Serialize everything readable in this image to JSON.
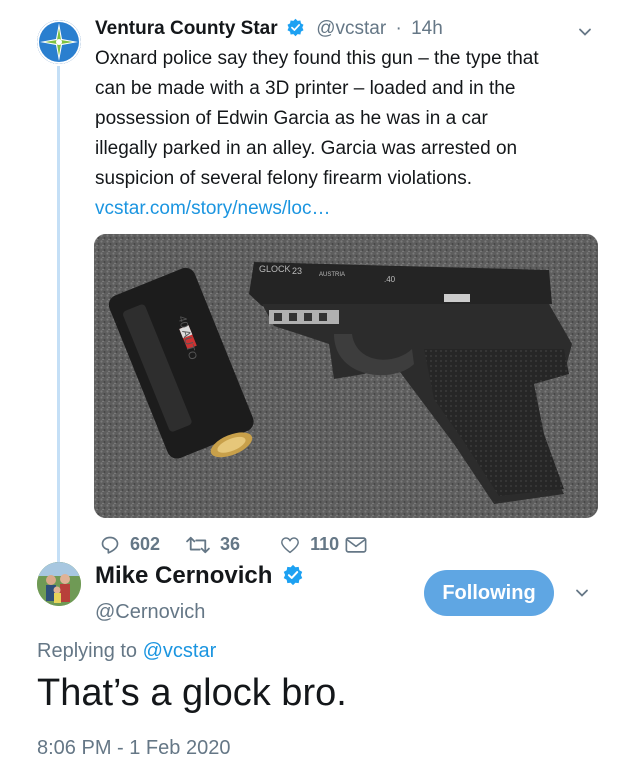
{
  "tweet": {
    "author_name": "Ventura County Star",
    "handle": "@vcstar",
    "separator": "·",
    "time": "14h",
    "lines": [
      "Oxnard police say they found this gun – the type that",
      "can be made with a 3D printer – loaded and in the",
      "possession of Edwin Garcia as he was in a car",
      "illegally parked in an alley. Garcia was arrested on",
      "suspicion of several felony firearm violations."
    ],
    "link": "vcstar.com/story/news/loc…",
    "media_description": "pistol with magazine photo",
    "media_icon": "photo-of-gun",
    "gun_labels": {
      "brand": "GLOCK",
      "model": "23",
      "origin": "AUSTRIA",
      "caliber": ".40",
      "magazine_label": "40 AUTO"
    },
    "replies": "602",
    "retweets": "36",
    "likes": "110"
  },
  "reply": {
    "author_name": "Mike Cernovich",
    "handle": "@Cernovich",
    "follow_label": "Following",
    "replying_prefix": "Replying to",
    "replying_to": "@vcstar",
    "text": "That’s a glock bro.",
    "timestamp": "8:06 PM - 1 Feb 2020"
  },
  "colors": {
    "accent": "#1b95e0",
    "muted": "#657786",
    "follow_button": "#5fa6e3",
    "thread_line": "#c4dff6"
  }
}
